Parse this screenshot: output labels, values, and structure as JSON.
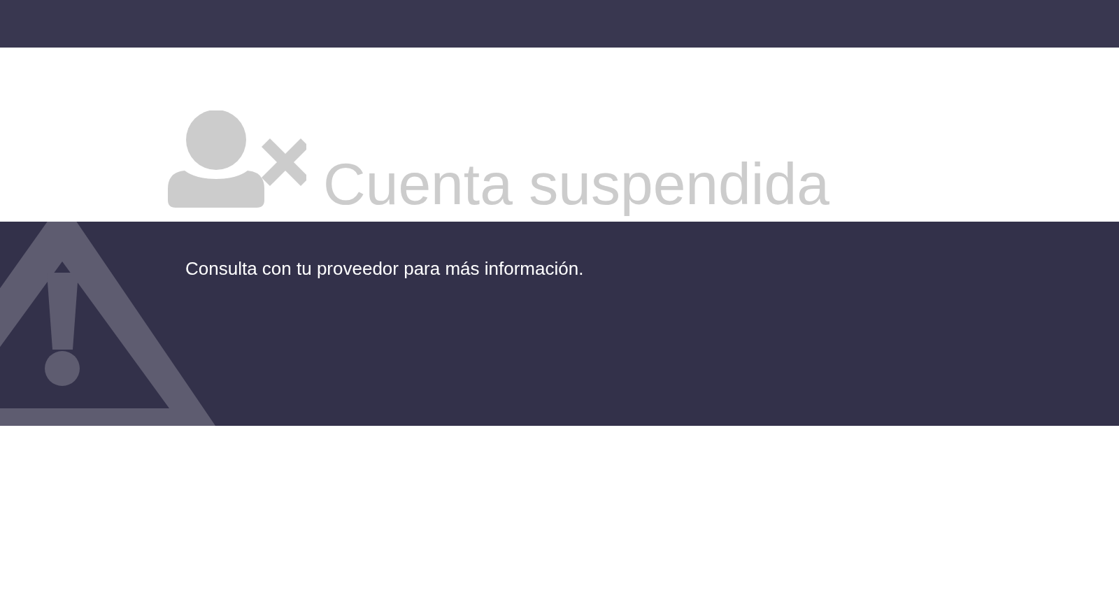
{
  "title": "Cuenta suspendida",
  "message": "Consulta con tu proveedor para más información."
}
